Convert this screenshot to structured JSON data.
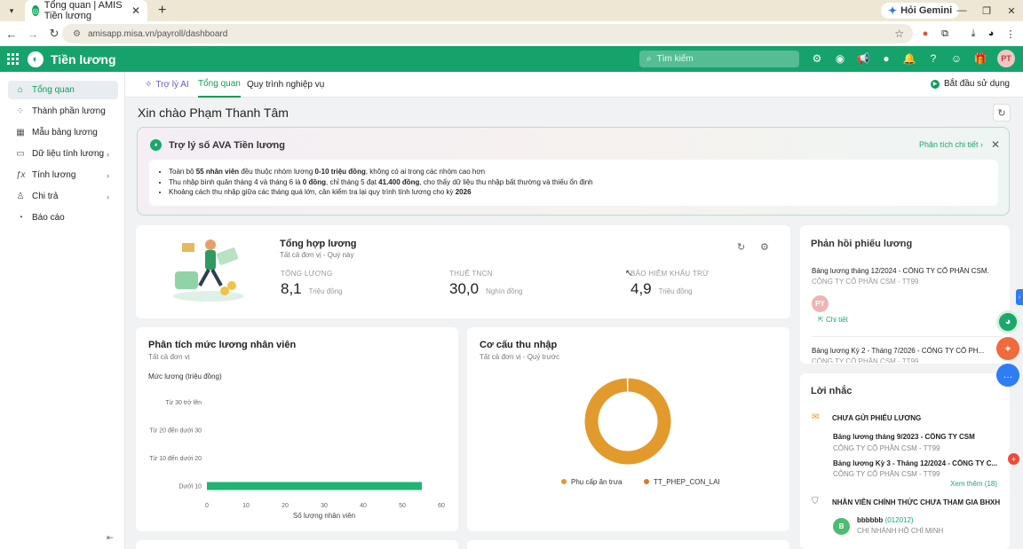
{
  "browser": {
    "tab_title": "Tổng quan | AMIS Tiền lương",
    "gemini_label": "Hỏi Gemini",
    "url": "amisapp.misa.vn/payroll/dashboard"
  },
  "app": {
    "title": "Tiền lương",
    "search_placeholder": "Tìm kiếm",
    "avatar": "PT"
  },
  "sidebar": {
    "items": [
      {
        "label": "Tổng quan",
        "icon": "home-icon"
      },
      {
        "label": "Thành phần lương",
        "icon": "components-icon"
      },
      {
        "label": "Mẫu bảng lương",
        "icon": "table-icon"
      },
      {
        "label": "Dữ liệu tính lương",
        "icon": "data-icon"
      },
      {
        "label": "Tính lương",
        "icon": "fx-icon"
      },
      {
        "label": "Chi trả",
        "icon": "wallet-icon"
      },
      {
        "label": "Báo cáo",
        "icon": "report-icon"
      }
    ]
  },
  "subnav": {
    "tabs": [
      "Trợ lý AI",
      "Tổng quan",
      "Quy trình nghiệp vụ"
    ],
    "start_label": "Bắt đầu sử dụng"
  },
  "greeting": "Xin chào Phạm Thanh Tâm",
  "ava": {
    "title": "Trợ lý số AVA Tiền lương",
    "link": "Phân tích chi tiết",
    "bullets": [
      [
        "Toàn bộ ",
        "55 nhân viên",
        " đều thuộc nhóm lương ",
        "0-10 triệu đồng",
        ", không có ai trong các nhóm cao hơn"
      ],
      [
        "Thu nhập bình quân tháng 4 và tháng 6 là ",
        "0 đồng",
        ", chỉ tháng 5 đạt ",
        "41.400 đồng",
        ", cho thấy dữ liệu thu nhập bất thường và thiếu ổn định"
      ],
      [
        "Khoảng cách thu nhập giữa các tháng quá lớn, cần kiểm tra lại quy trình tính lương cho kỳ ",
        "2026",
        "",
        "",
        ""
      ]
    ]
  },
  "summary": {
    "title": "Tổng hợp lương",
    "subtitle": "Tất cả đơn vị - Quý này",
    "metrics": [
      {
        "label": "TỔNG LƯƠNG",
        "value": "8,1",
        "unit": "Triệu đồng"
      },
      {
        "label": "THUẾ TNCN",
        "value": "30,0",
        "unit": "Nghìn đồng"
      },
      {
        "label": "BẢO HIỂM KHẤU TRỪ",
        "value": "4,9",
        "unit": "Triệu đồng"
      }
    ]
  },
  "payslip_feedback": {
    "title": "Phản hồi phiếu lương",
    "items": [
      {
        "name": "Bảng lương tháng 12/2024 - CÔNG TY CỔ PHẦN CSM.",
        "sub": "CÔNG TY CỔ PHẦN CSM - TT99",
        "avatar": "PY",
        "detail": "Chi tiết"
      },
      {
        "name": "Bảng lương Kỳ 2 - Tháng 7/2026 - CÔNG TY CỔ PH...",
        "sub": "CÔNG TY CỔ PHẦN CSM - TT99"
      }
    ]
  },
  "reminders": {
    "title": "Lời nhắc",
    "groups": [
      {
        "heading": "CHƯA GỬI PHIẾU LƯƠNG",
        "items": [
          {
            "name": "Bảng lương tháng 9/2023 - CÔNG TY CSM",
            "sub": "CÔNG TY CỔ PHẦN CSM - TT99"
          },
          {
            "name": "Bảng lương Kỳ 3 - Tháng 12/2024 - CÔNG TY C...",
            "sub": "CÔNG TY CỔ PHẦN CSM - TT99"
          }
        ],
        "more": "Xem thêm (18)"
      },
      {
        "heading": "NHÂN VIÊN CHÍNH THỨC CHƯA THAM GIA BHXH",
        "items": [
          {
            "avatar": "B",
            "name": "bbbbbb",
            "code": "(012012)",
            "sub": "CHI NHÁNH HỒ CHÍ MINH"
          }
        ]
      }
    ]
  },
  "salary_chart": {
    "title": "Phân tích mức lương nhân viên",
    "subtitle": "Tất cả đơn vị"
  },
  "income_chart": {
    "title": "Cơ cấu thu nhập",
    "subtitle": "Tất cả đơn vị - Quý trước"
  },
  "chart_data": [
    {
      "type": "bar",
      "orientation": "horizontal",
      "categories": [
        "Dưới 10",
        "Từ 10 đến dưới 20",
        "Từ 20 đến dưới 30",
        "Từ 30 trở lên"
      ],
      "values": [
        55,
        0,
        0,
        0
      ],
      "ylabel": "Mức lương (triệu đồng)",
      "xlabel": "Số lượng nhân viên",
      "xticks": [
        0,
        10,
        20,
        30,
        40,
        50,
        60
      ],
      "xlim": [
        0,
        60
      ],
      "color": "#1fb374"
    },
    {
      "type": "pie",
      "donut": true,
      "labels": [
        "Phụ cấp ăn trưa",
        "TT_PHEP_CON_LAI"
      ],
      "values": [
        99.8,
        0.2
      ],
      "colors": [
        "#e39a2c",
        "#e2752b"
      ],
      "legend": "bottom"
    }
  ]
}
